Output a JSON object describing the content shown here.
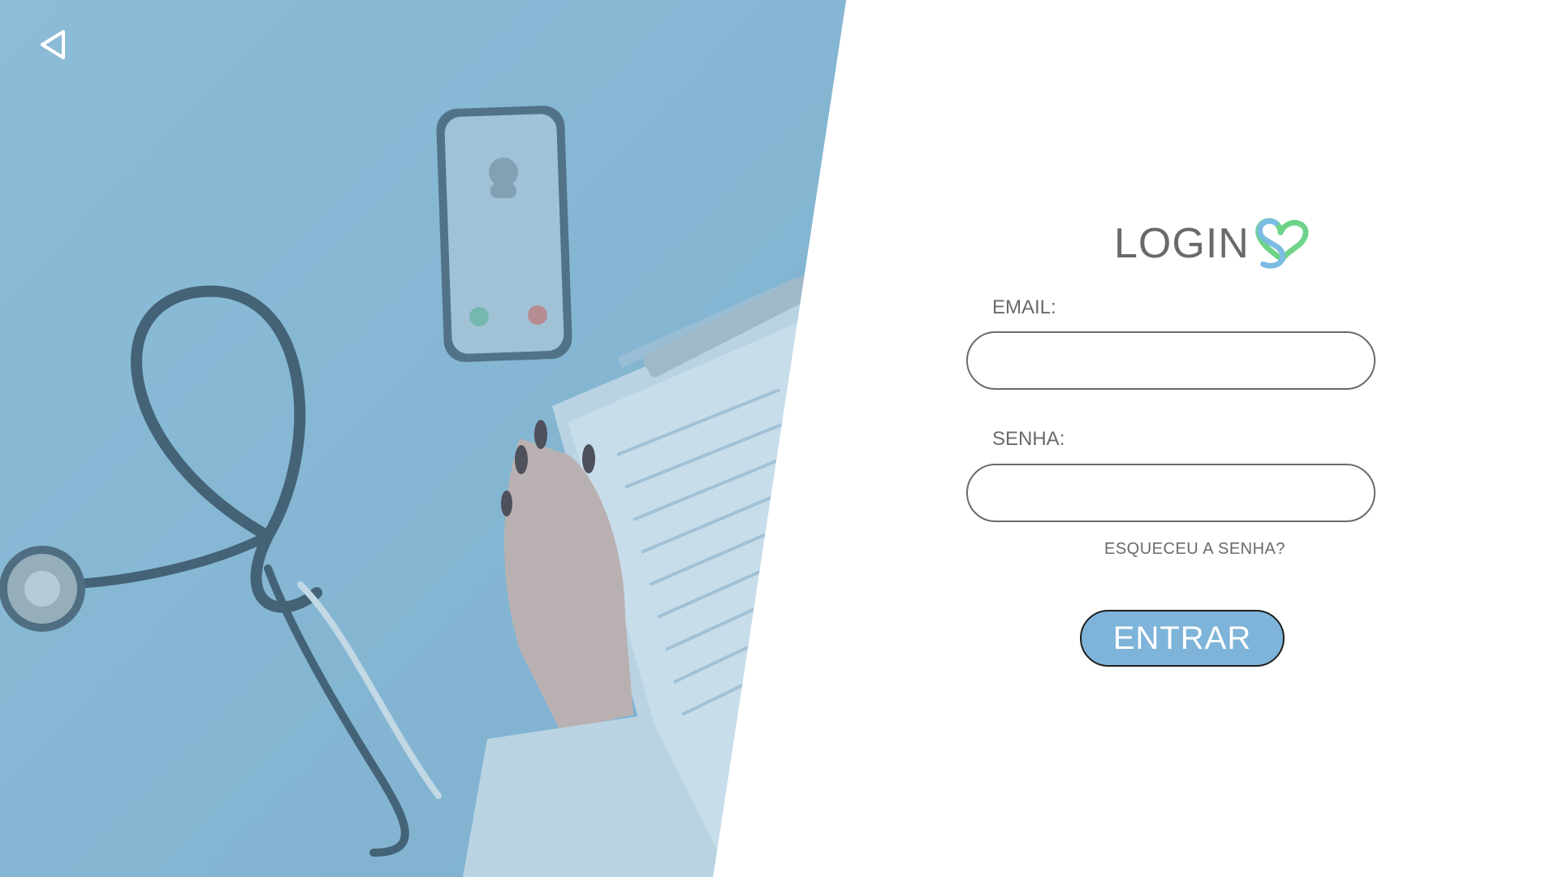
{
  "header": {
    "back_icon": "back-triangle-icon"
  },
  "login": {
    "title": "LOGIN",
    "logo_icon": "heart-logo-icon",
    "email_label": "EMAIL:",
    "email_value": "",
    "email_placeholder": "",
    "password_label": "SENHA:",
    "password_value": "",
    "password_placeholder": "",
    "forgot_password": "ESQUECEU A SENHA?",
    "submit_label": "ENTRAR"
  },
  "colors": {
    "accent": "#7eb4d9",
    "panel_tint": "#86b4d1",
    "text_gray": "#6a6a6a",
    "logo_blue": "#7bbce0",
    "logo_green": "#6fd38a"
  }
}
